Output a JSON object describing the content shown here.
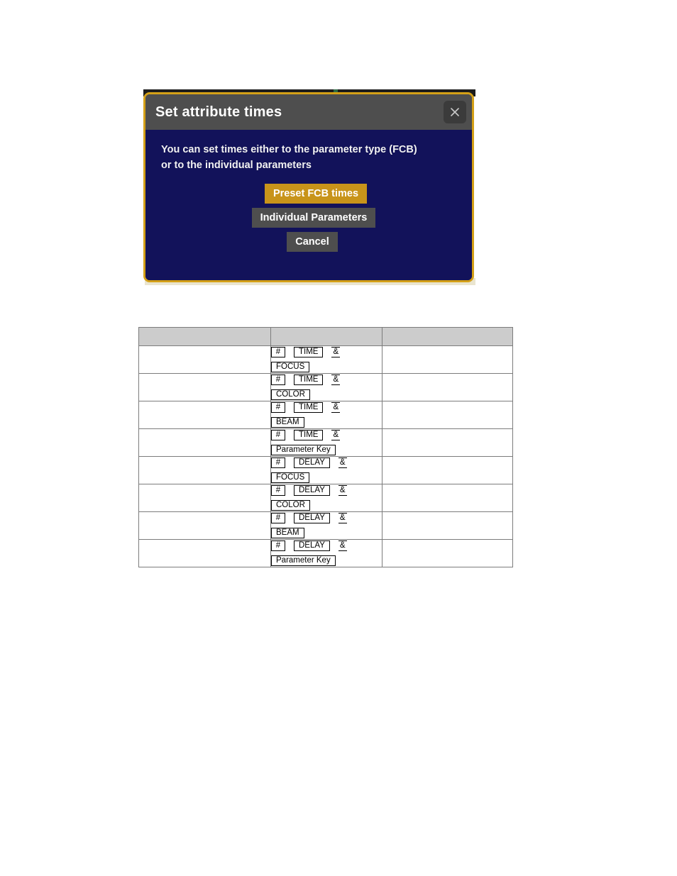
{
  "dialog": {
    "title": "Set attribute times",
    "close_icon": "close-icon",
    "message": "You can set times either to the parameter type (FCB)\nor to the individual parameters",
    "buttons": {
      "preset": "Preset FCB times",
      "individual": "Individual Parameters",
      "cancel": "Cancel"
    },
    "colors": {
      "border": "#d4a017",
      "body_background": "#12125a",
      "titlebar": "#4e4e4e",
      "primary_button": "#c8941a",
      "secondary_button": "#4e4e4e",
      "title_text": "#ffffff"
    }
  },
  "key_table": {
    "headers": [
      "",
      "",
      ""
    ],
    "separator": "&",
    "rows": [
      {
        "description": "",
        "keys_line1": [
          "#",
          "TIME"
        ],
        "keys_line2": [
          "FOCUS"
        ],
        "notes": ""
      },
      {
        "description": "",
        "keys_line1": [
          "#",
          "TIME"
        ],
        "keys_line2": [
          "COLOR"
        ],
        "notes": ""
      },
      {
        "description": "",
        "keys_line1": [
          "#",
          "TIME"
        ],
        "keys_line2": [
          "BEAM"
        ],
        "notes": ""
      },
      {
        "description": "",
        "keys_line1": [
          "#",
          "TIME"
        ],
        "keys_line2": [
          "Parameter Key"
        ],
        "notes": ""
      },
      {
        "description": "",
        "keys_line1": [
          "#",
          "DELAY"
        ],
        "keys_line2": [
          "FOCUS"
        ],
        "notes": ""
      },
      {
        "description": "",
        "keys_line1": [
          "#",
          "DELAY"
        ],
        "keys_line2": [
          "COLOR"
        ],
        "notes": ""
      },
      {
        "description": "",
        "keys_line1": [
          "#",
          "DELAY"
        ],
        "keys_line2": [
          "BEAM"
        ],
        "notes": ""
      },
      {
        "description": "",
        "keys_line1": [
          "#",
          "DELAY"
        ],
        "keys_line2": [
          "Parameter Key"
        ],
        "notes": ""
      }
    ]
  }
}
